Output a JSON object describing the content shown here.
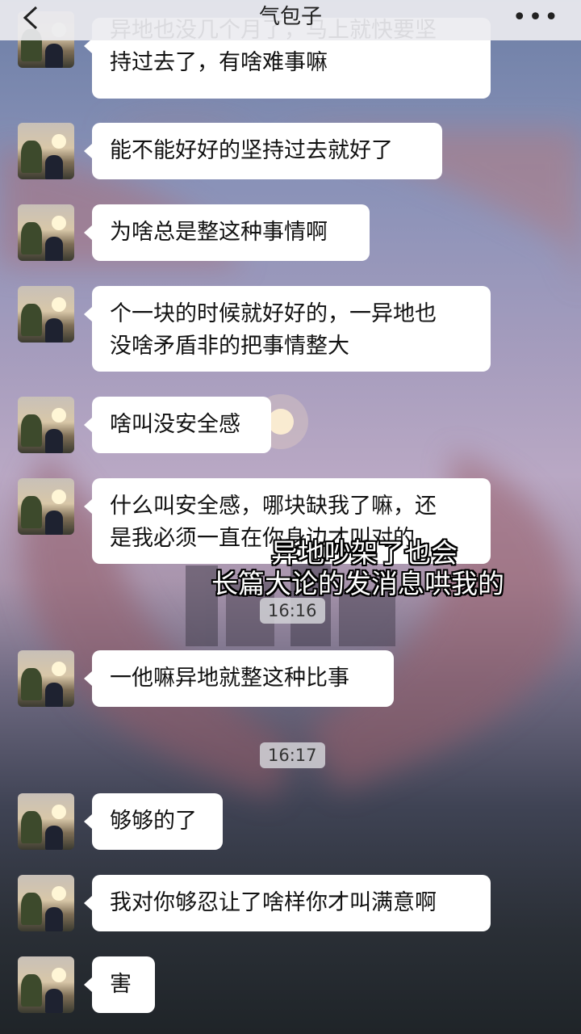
{
  "header": {
    "title": "气包子",
    "back_icon": "chevron-left-icon",
    "more_icon": "ellipsis-icon",
    "more_glyph": "•••"
  },
  "messages": [
    {
      "line1": "异地也没几个月了，马上就快要坚",
      "line2": "持过去了，有啥难事嘛"
    },
    {
      "line1": "能不能好好的坚持过去就好了"
    },
    {
      "line1": "为啥总是整这种事情啊"
    },
    {
      "line1": "个一块的时候就好好的，一异地也",
      "line2": "没啥矛盾非的把事情整大"
    },
    {
      "line1": "啥叫没安全感"
    },
    {
      "line1": "什么叫安全感，哪块缺我了嘛，还",
      "line2": "是我必须一直在你身边才叫对的"
    },
    {
      "line1": "一他嘛异地就整这种比事"
    },
    {
      "line1": "够够的了"
    },
    {
      "line1": "我对你够忍让了啥样你才叫满意啊"
    },
    {
      "line1": "害"
    }
  ],
  "timestamps": [
    "16:16",
    "16:17"
  ],
  "caption": {
    "line1": "异地吵架了也会",
    "line2": "长篇大论的发消息哄我的"
  }
}
